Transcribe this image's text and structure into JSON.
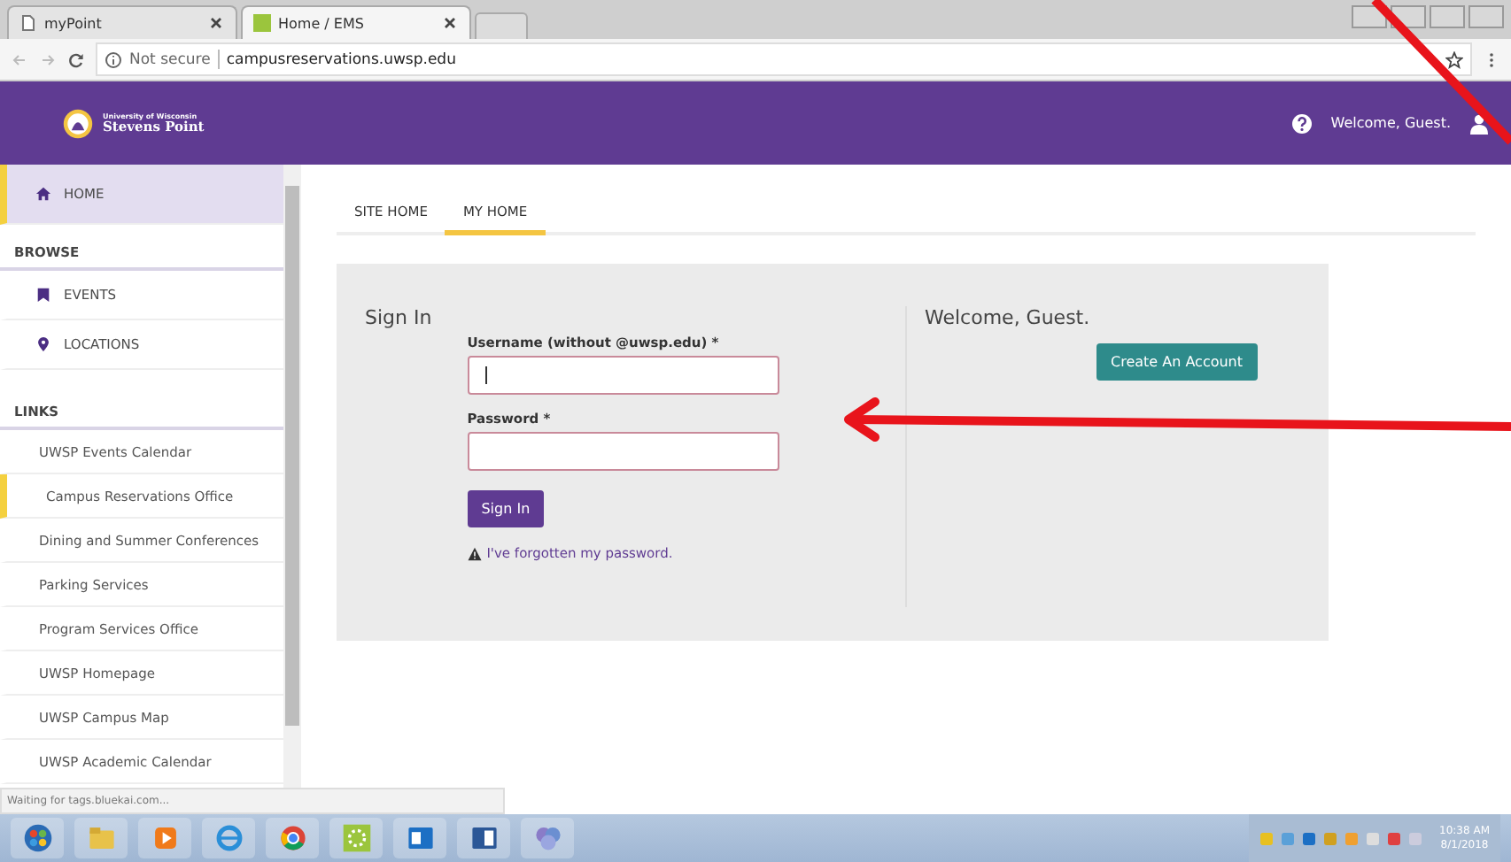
{
  "browser": {
    "tabs": [
      {
        "title": "myPoint",
        "selected": false
      },
      {
        "title": "Home / EMS",
        "selected": true
      }
    ],
    "address": {
      "security": "Not secure",
      "url": "campusreservations.uwsp.edu"
    }
  },
  "header": {
    "logo_small": "University of Wisconsin",
    "logo_large": "Stevens Point",
    "welcome": "Welcome, Guest."
  },
  "sidebar": {
    "items": [
      {
        "kind": "nav",
        "label": "HOME",
        "selected": true
      },
      {
        "kind": "heading",
        "label": "BROWSE"
      },
      {
        "kind": "nav",
        "label": "EVENTS",
        "selected": false
      },
      {
        "kind": "nav",
        "label": "LOCATIONS",
        "selected": false
      },
      {
        "kind": "heading",
        "label": "LINKS"
      },
      {
        "kind": "link",
        "label": "UWSP Events Calendar",
        "selected": false
      },
      {
        "kind": "link",
        "label": "Campus Reservations Office",
        "selected": true
      },
      {
        "kind": "link",
        "label": "Dining and Summer Conferences",
        "selected": false
      },
      {
        "kind": "link",
        "label": "Parking Services",
        "selected": false
      },
      {
        "kind": "link",
        "label": "Program Services Office",
        "selected": false
      },
      {
        "kind": "link",
        "label": "UWSP Homepage",
        "selected": false
      },
      {
        "kind": "link",
        "label": "UWSP Campus Map",
        "selected": false
      },
      {
        "kind": "link",
        "label": "UWSP Academic Calendar",
        "selected": false
      }
    ]
  },
  "page_tabs": [
    {
      "label": "SITE HOME",
      "selected": false
    },
    {
      "label": "MY HOME",
      "selected": true
    }
  ],
  "sign_in": {
    "title": "Sign In",
    "username_label": "Username (without @uwsp.edu) *",
    "password_label": "Password *",
    "button": "Sign In",
    "forgot_link": "I've forgotten my password."
  },
  "welcome_panel": {
    "title": "Welcome, Guest.",
    "button": "Create An Account"
  },
  "status_text": "Waiting for tags.bluekai.com...",
  "taskbar": {
    "time": "10:38 AM",
    "date": "8/1/2018"
  }
}
